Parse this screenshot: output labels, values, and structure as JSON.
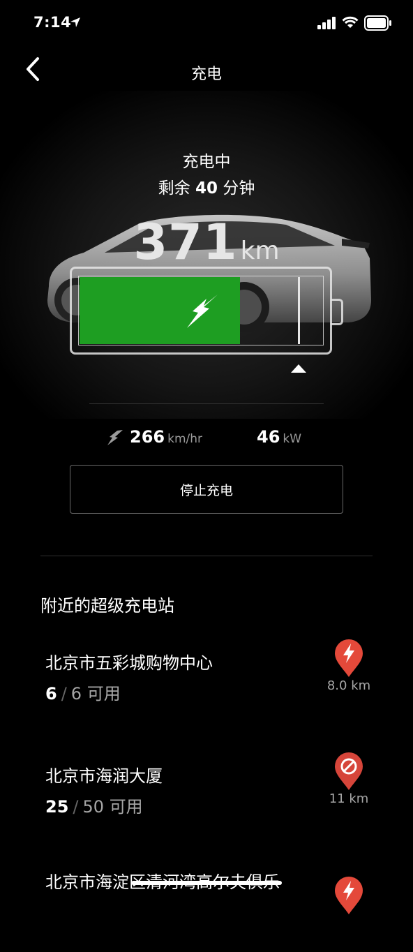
{
  "status_bar": {
    "time": "7:14"
  },
  "nav": {
    "title": "充电"
  },
  "charging": {
    "status": "充电中",
    "remaining_prefix": "剩余",
    "remaining_minutes": "40",
    "remaining_suffix": "分钟",
    "range_value": "371",
    "range_unit": "km",
    "battery_level": 0.66,
    "charge_limit": 0.9,
    "colors": {
      "fill": "#1e9e22",
      "outline": "#e6e6e6"
    }
  },
  "stats": {
    "speed_value": "266",
    "speed_unit": "km/hr",
    "power_value": "46",
    "power_unit": "kW"
  },
  "stop_button": {
    "label": "停止充电"
  },
  "nearby": {
    "title": "附近的超级充电站",
    "stations": [
      {
        "name": "北京市五彩城购物中心",
        "available": "6",
        "total": "6",
        "available_label": "可用",
        "distance": "8.0 km",
        "icon": "supercharger-bolt-icon",
        "pin_color": "#e4493a"
      },
      {
        "name": "北京市海润大厦",
        "available": "25",
        "total": "50",
        "available_label": "可用",
        "distance": "11 km",
        "icon": "prohibited-icon",
        "pin_color": "#d6453a"
      },
      {
        "name": "北京市海淀区清河湾高尔夫俱乐",
        "icon": "supercharger-bolt-icon",
        "pin_color": "#e4493a"
      }
    ]
  }
}
